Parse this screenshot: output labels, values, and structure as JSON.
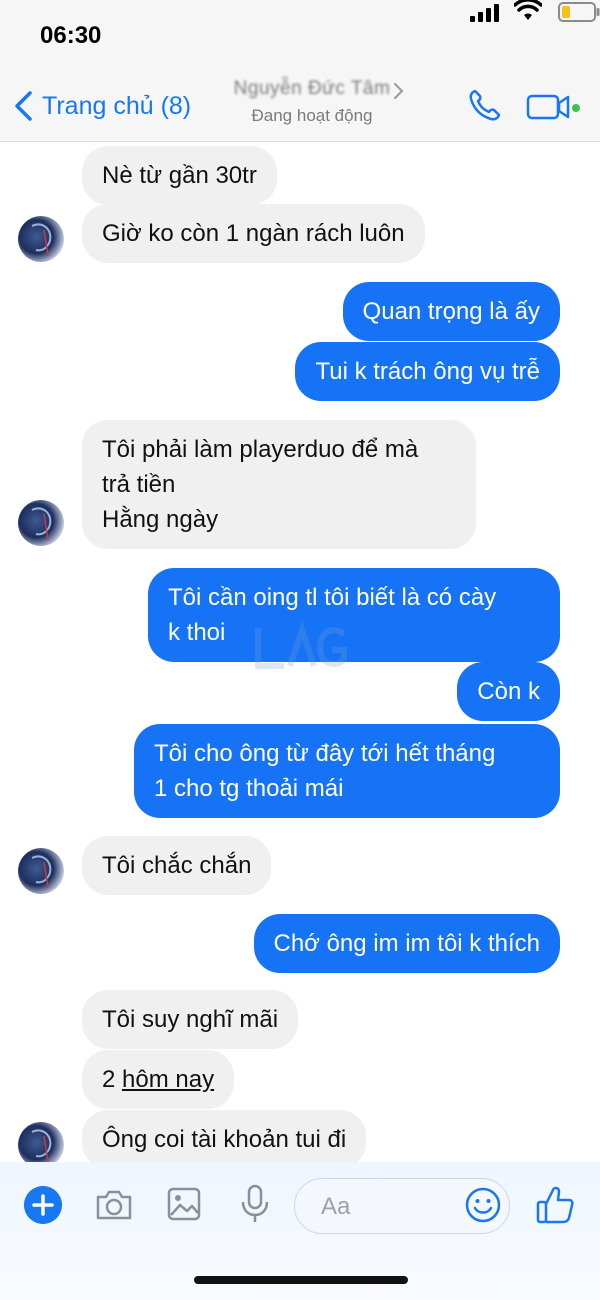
{
  "status_bar": {
    "time": "06:30"
  },
  "header": {
    "back_label": "Trang chủ (8)",
    "contact_name": "Nguyễn Đức Tâm",
    "contact_status": "Đang hoạt động"
  },
  "messages": [
    {
      "side": "in",
      "text": "Nè từ gần 30tr"
    },
    {
      "side": "in",
      "text": "Giờ ko còn 1 ngàn rách luôn"
    },
    {
      "side": "out",
      "text": "Quan trọng là ấy"
    },
    {
      "side": "out",
      "text": "Tui k trách ông vụ trễ"
    },
    {
      "side": "in",
      "lines": [
        "Tôi phải làm playerduo để mà",
        "trả tiền",
        "Hằng ngày"
      ]
    },
    {
      "side": "out",
      "lines": [
        "Tôi cần oing tl tôi biết là có cày",
        "k thoi"
      ]
    },
    {
      "side": "out",
      "text": "Còn k"
    },
    {
      "side": "out",
      "lines": [
        "Tôi cho ông từ đây tới hết tháng",
        "1 cho tg thoải mái"
      ]
    },
    {
      "side": "in",
      "text": "Tôi chắc chắn"
    },
    {
      "side": "out",
      "text": "Chớ ông im im tôi k thích"
    },
    {
      "side": "in",
      "text": "Tôi suy nghĩ mãi"
    },
    {
      "side": "in",
      "prefix": "2 ",
      "underlined": "hôm nay"
    },
    {
      "side": "in",
      "text": "Ông coi tài khoản tui đi"
    }
  ],
  "composer": {
    "placeholder": "Aa"
  },
  "colors": {
    "accent": "#1877f2",
    "outgoing_bubble": "#1673f5",
    "incoming_bubble": "#f0f0f0"
  }
}
